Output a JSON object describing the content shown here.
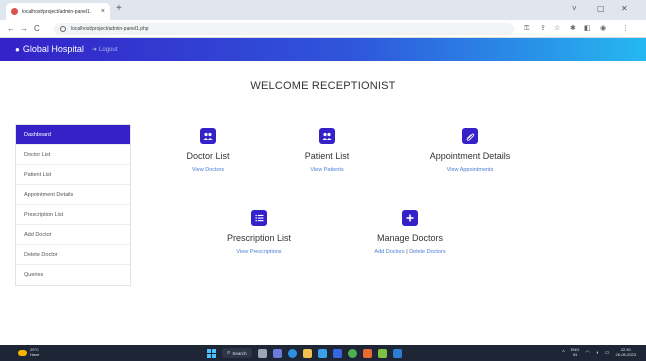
{
  "browser": {
    "tab_title": "localhost/project/admin-panel1.",
    "url": "localhost/project/admin-panel1.php",
    "new_tab": "+",
    "tab_close": "×",
    "back": "←",
    "forward": "→",
    "reload": "C",
    "minimize": "˅",
    "restore": "▢",
    "close": "✕"
  },
  "header": {
    "brand_icon": "users-icon",
    "brand": "Global Hospital",
    "logout_icon": "logout-icon",
    "logout": "Logout"
  },
  "page": {
    "welcome": "WELCOME RECEPTIONIST"
  },
  "sidebar": {
    "items": [
      {
        "label": "Dashboard"
      },
      {
        "label": "Doctor List"
      },
      {
        "label": "Patient List"
      },
      {
        "label": "Appointment Details"
      },
      {
        "label": "Prescription List"
      },
      {
        "label": "Add Doctor"
      },
      {
        "label": "Delete Doctor"
      },
      {
        "label": "Queries"
      }
    ]
  },
  "cards": {
    "doctor": {
      "icon": "users-icon",
      "title": "Doctor List",
      "link": "View Doctors"
    },
    "patient": {
      "icon": "users-icon",
      "title": "Patient List",
      "link": "View Patients"
    },
    "appointment": {
      "icon": "paperclip-icon",
      "title": "Appointment Details",
      "link": "View Appointments"
    },
    "prescription": {
      "icon": "list-icon",
      "title": "Prescription List",
      "link": "View Prescriptions"
    },
    "manage": {
      "icon": "plus-icon",
      "title": "Manage Doctors",
      "link_add": "Add Doctors",
      "separator": "|",
      "link_delete": "Delete Doctors"
    }
  },
  "taskbar": {
    "weather_temp": "29°C",
    "weather_desc": "Haze",
    "search": "Search",
    "lang": "ENG",
    "lang_region": "IN",
    "time": "22:30",
    "date": "26-05-2023"
  },
  "colors": {
    "primary": "#3422c8",
    "header_gradient_end": "#25b8f0",
    "link": "#4a7fd4"
  }
}
